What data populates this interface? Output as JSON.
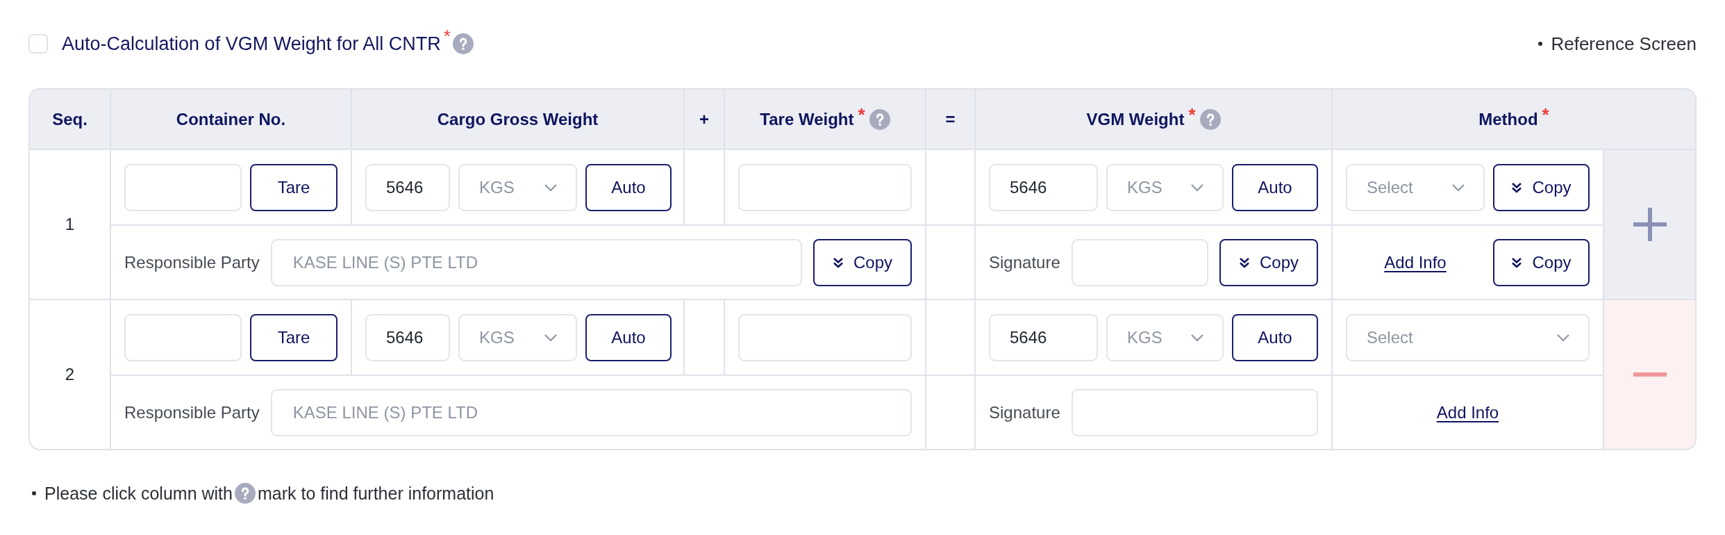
{
  "auto_calculation": {
    "label": "Auto-Calculation of VGM Weight for All CNTR",
    "checked": false,
    "required_mark": "*",
    "help": true
  },
  "reference_link": {
    "label": "Reference Screen"
  },
  "table": {
    "columns": [
      {
        "label": "Seq."
      },
      {
        "label": "Container No."
      },
      {
        "label": "Cargo Gross Weight"
      },
      {
        "label": "+"
      },
      {
        "label": "Tare Weight",
        "required_mark": "*",
        "help": true
      },
      {
        "label": "="
      },
      {
        "label": "VGM Weight",
        "required_mark": "*",
        "help": true
      },
      {
        "label": "Method",
        "required_mark": "*"
      }
    ],
    "rows": [
      {
        "seq": "1",
        "container": {
          "button": "Tare"
        },
        "cargo_gross_weight": {
          "value": "5646",
          "unit": {
            "value": "KGS",
            "disabled": true
          },
          "button": "Auto"
        },
        "vgm_weight": {
          "value": "5646",
          "unit": {
            "value": "KGS",
            "disabled": true
          },
          "button": "Auto"
        },
        "method": {
          "placeholder": "Select",
          "copy_button": "Copy"
        },
        "responsible_party": {
          "label": "Responsible Party",
          "value": "KASE LINE (S) PTE LTD",
          "disabled": true,
          "copy_button": "Copy"
        },
        "signature": {
          "label": "Signature",
          "copy_button": "Copy"
        },
        "additional_info": {
          "link": "Add Info",
          "copy_button": "Copy"
        },
        "action": {
          "kind": "add"
        }
      },
      {
        "seq": "2",
        "container": {
          "button": "Tare"
        },
        "cargo_gross_weight": {
          "value": "5646",
          "unit": {
            "value": "KGS",
            "disabled": true
          },
          "button": "Auto"
        },
        "vgm_weight": {
          "value": "5646",
          "unit": {
            "value": "KGS",
            "disabled": true
          },
          "button": "Auto"
        },
        "method": {
          "placeholder": "Select"
        },
        "responsible_party": {
          "label": "Responsible Party",
          "value": "KASE LINE (S) PTE LTD",
          "disabled": true
        },
        "signature": {
          "label": "Signature"
        },
        "additional_info": {
          "link": "Add Info"
        },
        "action": {
          "kind": "remove"
        }
      }
    ]
  },
  "note": {
    "before_icon": "Please click column with",
    "after_icon": "mark to find further information",
    "help": true
  }
}
